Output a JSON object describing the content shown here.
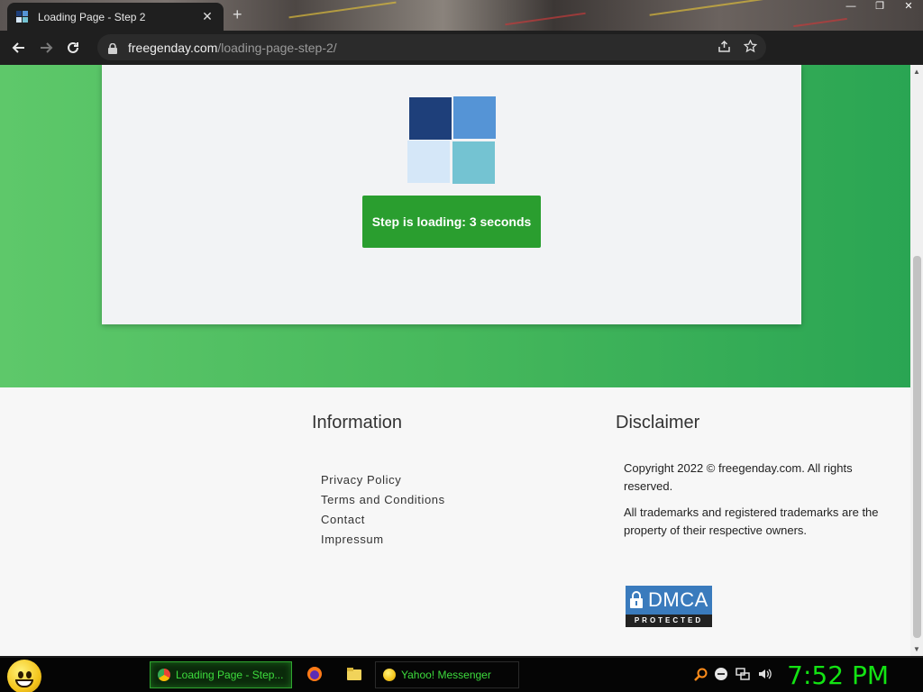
{
  "browser": {
    "tab_title": "Loading Page - Step 2",
    "tab_close": "✕",
    "new_tab": "+",
    "window_controls": [
      "—",
      "❐",
      "✕"
    ],
    "url_host": "freegenday.com",
    "url_path": "/loading-page-step-2/"
  },
  "page": {
    "loading_button": "Step is loading: 3 seconds",
    "footer": {
      "information_title": "Information",
      "links": [
        "Privacy Policy",
        "Terms and Conditions",
        "Contact",
        "Impressum"
      ],
      "disclaimer_title": "Disclaimer",
      "copyright": "Copyright 2022 © freegenday.com. All rights reserved.",
      "trademarks": "All trademarks and registered trademarks are the property of their respective owners.",
      "dmca_word": "DMCA",
      "dmca_sub": "PROTECTED"
    }
  },
  "taskbar": {
    "tasks": [
      {
        "label": "Loading Page - Step...",
        "active": true
      },
      {
        "label": "Yahoo! Messenger",
        "active": false
      }
    ],
    "clock": "7:52 PM"
  },
  "colors": {
    "hero_green": "#46b85c",
    "button_green": "#2a9e2f",
    "clock_green": "#13e313",
    "logo": [
      "#1e3f7a",
      "#5594d6",
      "#d5e7f8",
      "#74c3d2"
    ]
  }
}
